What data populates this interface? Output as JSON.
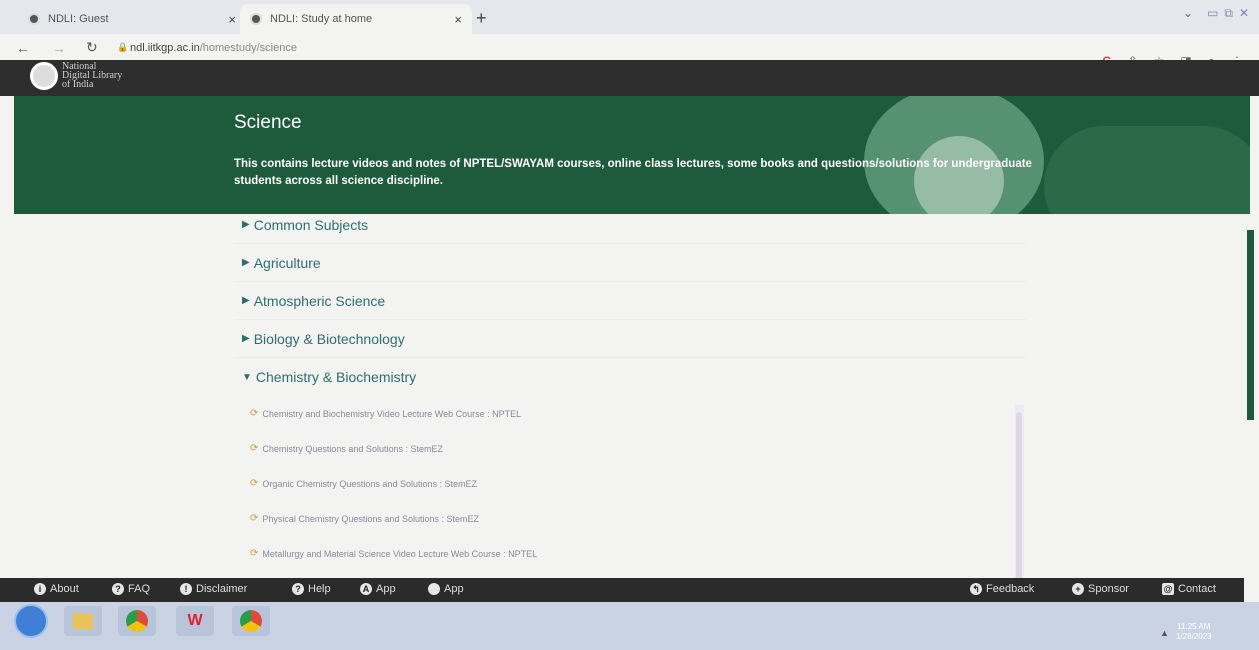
{
  "browser": {
    "tabs": [
      {
        "label": "NDLI: Guest",
        "active": false
      },
      {
        "label": "NDLI: Study at home",
        "active": true
      }
    ],
    "new_tab": "+",
    "tab_close": "×",
    "url_host": "ndl.iitkgp.ac.in",
    "url_path": "/homestudy/science",
    "window_controls": [
      "⌄",
      "▭",
      "⧉",
      "✕"
    ]
  },
  "site": {
    "logo_text": [
      "National",
      "Digital Library",
      "of India"
    ]
  },
  "hero": {
    "title": "Science",
    "description": "This contains lecture videos and notes of NPTEL/SWAYAM courses, online class lectures, some books and questions/solutions for undergraduate students across all science discipline."
  },
  "subjects": [
    {
      "label": "Common Subjects",
      "expanded": false
    },
    {
      "label": "Agriculture",
      "expanded": false
    },
    {
      "label": "Atmospheric Science",
      "expanded": false
    },
    {
      "label": "Biology & Biotechnology",
      "expanded": false
    },
    {
      "label": "Chemistry & Biochemistry",
      "expanded": true
    }
  ],
  "chemistry_courses": [
    "Chemistry and Biochemistry Video Lecture Web Course : NPTEL",
    "Chemistry Questions and Solutions : StemEZ",
    "Organic Chemistry Questions and Solutions : StemEZ",
    "Physical Chemistry Questions and Solutions : StemEZ",
    "Metallurgy and Material Science Video Lecture Web Course : NPTEL"
  ],
  "footer": {
    "about": "About",
    "faq": "FAQ",
    "disclaimer": "Disclaimer",
    "help": "Help",
    "app_android": "App",
    "app_ios": "App",
    "feedback": "Feedback",
    "sponsor": "Sponsor",
    "contact": "Contact"
  },
  "taskbar": {
    "time": "11:25 AM",
    "date": "1/28/2023"
  },
  "colors": {
    "hero_green": "#1e5a3c",
    "link_teal": "#2d6f70",
    "footer_dark": "#2b2b2b"
  }
}
